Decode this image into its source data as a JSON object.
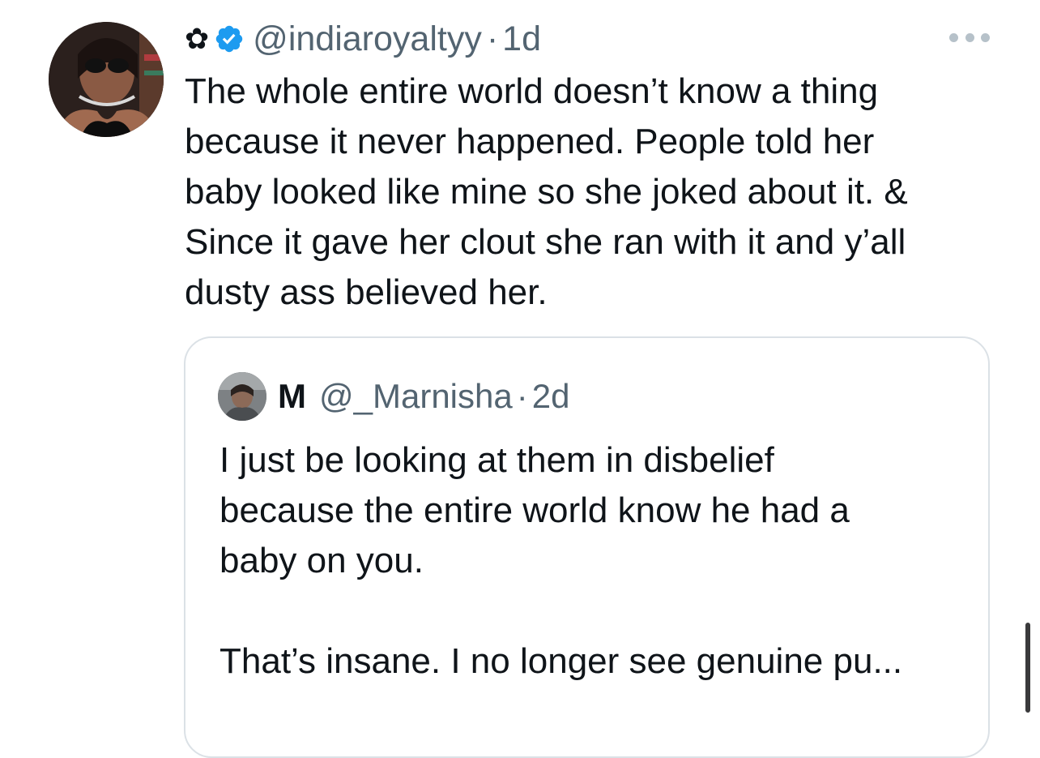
{
  "tweet": {
    "flower_icon": "✿",
    "handle": "@indiaroyaltyy",
    "separator": "·",
    "time": "1d",
    "text": "The whole entire world doesn’t know a thing\nbecause it never happened. People told her\nbaby looked like mine so she joked about it. &\nSince it gave her clout she ran with it and y’all\ndusty ass believed her.",
    "icons": {
      "avatar": "profile-photo",
      "verified": "verified-badge-icon",
      "more": "more-options-icon"
    }
  },
  "quote": {
    "name": "M",
    "handle": "@_Marnisha",
    "separator": "·",
    "time": "2d",
    "text": "I just be looking at them in disbelief\nbecause the entire world know he had a\nbaby on you.\n\nThat’s insane. I no longer see genuine pu..."
  },
  "colors": {
    "text_primary": "#0f1419",
    "text_secondary": "#536471",
    "verified_blue": "#1d9bf0",
    "border": "#dbe1e6"
  }
}
